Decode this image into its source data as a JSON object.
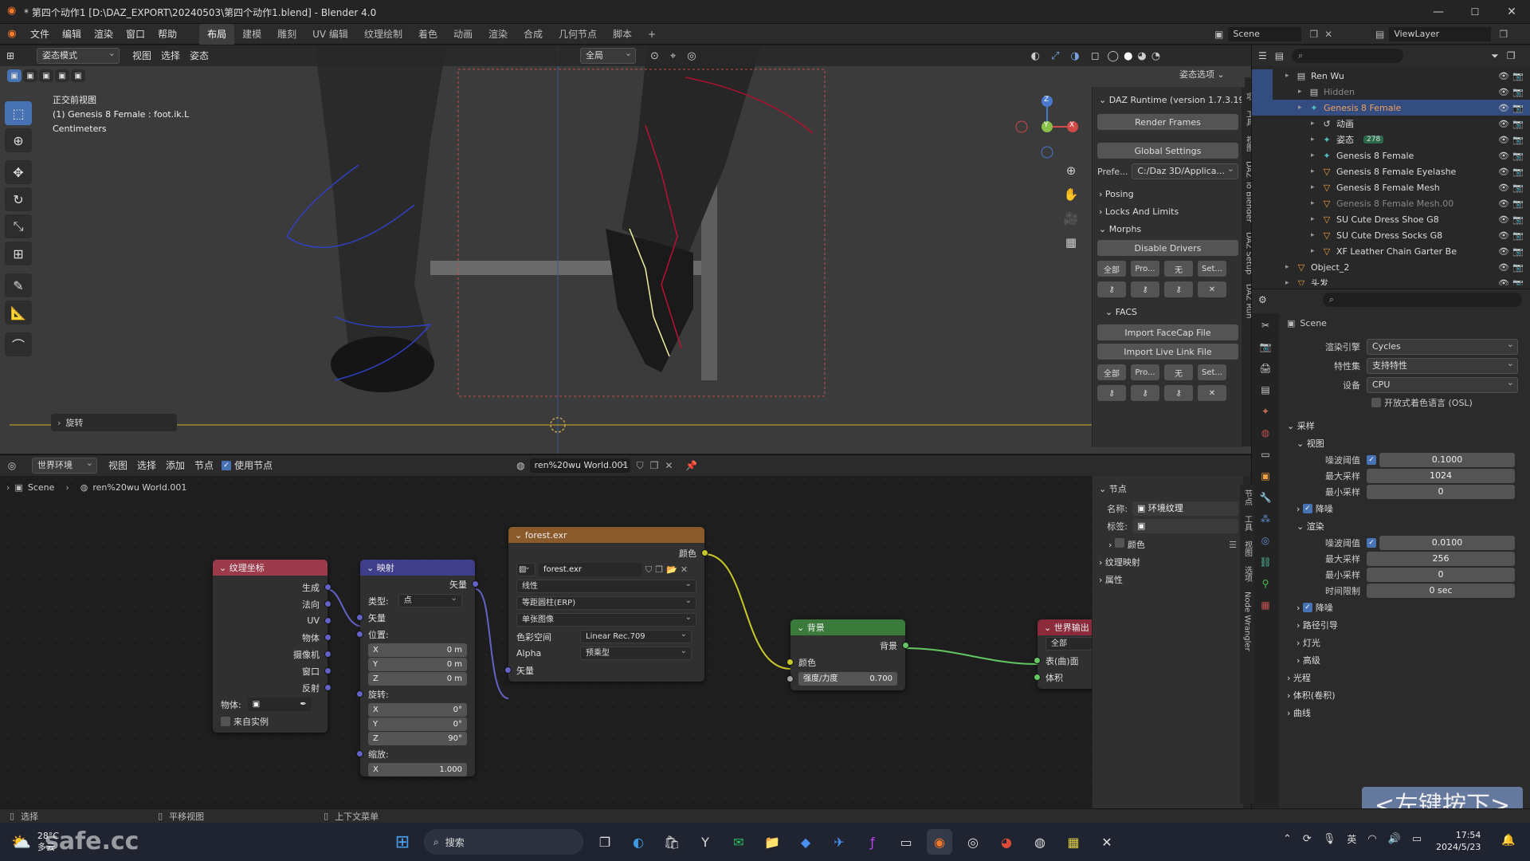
{
  "window": {
    "title": "* 第四个动作1 [D:\\DAZ_EXPORT\\20240503\\第四个动作1.blend] - Blender 4.0",
    "minimize": "—",
    "maximize": "☐",
    "close": "✕"
  },
  "menu": {
    "items": [
      "文件",
      "编辑",
      "渲染",
      "窗口",
      "帮助"
    ],
    "workspace_tabs": [
      "布局",
      "建模",
      "雕刻",
      "UV 编辑",
      "纹理绘制",
      "着色",
      "动画",
      "渲染",
      "合成",
      "几何节点",
      "脚本"
    ],
    "active_tab": "布局",
    "add_tab": "+",
    "scene_label": "Scene",
    "viewlayer_label": "ViewLayer"
  },
  "viewport": {
    "mode": "姿态模式",
    "menus": [
      "视图",
      "选择",
      "姿态"
    ],
    "orientation": "全局",
    "options": "姿态选项",
    "info_line1": "正交前视图",
    "info_line2": "(1) Genesis 8 Female : foot.ik.L",
    "info_line3": "Centimeters",
    "last_op": "旋转",
    "gizmo": {
      "z": "Z",
      "y": "Y",
      "x": "X"
    }
  },
  "npanel": {
    "header": "DAZ Runtime (version 1.7.3.19",
    "render_frames": "Render Frames",
    "global_settings": "Global Settings",
    "prefs_label": "Prefe...",
    "prefs_value": "C:/Daz 3D/Applica...",
    "posing": "Posing",
    "locks": "Locks And Limits",
    "morphs": "Morphs",
    "disable_drivers": "Disable Drivers",
    "small_btns": [
      "全部",
      "Pro...",
      "无",
      "Set..."
    ],
    "facs": "FACS",
    "import_facecap": "Import FaceCap File",
    "import_livelink": "Import Live Link File",
    "tabs": [
      "项",
      "工具",
      "视图",
      "DAZ To Blender",
      "DAZ Setup",
      "DAZ Run"
    ]
  },
  "outliner": {
    "rows": [
      {
        "label": "Ren Wu",
        "indent": 1,
        "icon": "▤",
        "color": "#ddd"
      },
      {
        "label": "Hidden",
        "indent": 2,
        "icon": "▤",
        "color": "#888"
      },
      {
        "label": "Genesis 8 Female",
        "indent": 2,
        "icon": "✦",
        "color": "#f0a060",
        "sel": true
      },
      {
        "label": "动画",
        "indent": 3,
        "icon": "↺",
        "color": "#ddd"
      },
      {
        "label": "姿态",
        "indent": 3,
        "icon": "✦",
        "color": "#ddd"
      },
      {
        "label": "Genesis 8 Female",
        "indent": 3,
        "icon": "✦",
        "color": "#ddd"
      },
      {
        "label": "Genesis 8 Female Eyelashe",
        "indent": 3,
        "icon": "▽",
        "color": "#ddd"
      },
      {
        "label": "Genesis 8 Female Mesh",
        "indent": 3,
        "icon": "▽",
        "color": "#ddd"
      },
      {
        "label": "Genesis 8 Female Mesh.00",
        "indent": 3,
        "icon": "▽",
        "color": "#888"
      },
      {
        "label": "SU Cute Dress Shoe G8",
        "indent": 3,
        "icon": "▽",
        "color": "#ddd"
      },
      {
        "label": "SU Cute Dress Socks G8",
        "indent": 3,
        "icon": "▽",
        "color": "#ddd"
      },
      {
        "label": "XF Leather Chain Garter Be",
        "indent": 3,
        "icon": "▽",
        "color": "#ddd"
      },
      {
        "label": "Object_2",
        "indent": 1,
        "icon": "▽",
        "color": "#ddd"
      },
      {
        "label": "头发",
        "indent": 1,
        "icon": "▽",
        "color": "#ddd"
      }
    ],
    "badge": "278"
  },
  "properties": {
    "scene": "Scene",
    "render_engine_label": "渲染引擎",
    "render_engine": "Cycles",
    "feature_set_label": "特性集",
    "feature_set": "支持特性",
    "device_label": "设备",
    "device": "CPU",
    "osl": "开放式着色语言 (OSL)",
    "sampling": "采样",
    "viewport": "视图",
    "noise_threshold_label": "噪波阈值",
    "viewport_noise": "0.1000",
    "max_samples_label": "最大采样",
    "viewport_max": "1024",
    "min_samples_label": "最小采样",
    "viewport_min": "0",
    "denoise": "降噪",
    "render": "渲染",
    "render_noise": "0.0100",
    "render_max": "256",
    "render_min": "0",
    "time_limit_label": "时间限制",
    "time_limit": "0 sec",
    "path_guiding": "路径引导",
    "lights": "灯光",
    "advanced": "高级",
    "light_paths": "光程",
    "volumes": "体积(卷积)",
    "curves": "曲线"
  },
  "node_editor": {
    "type": "世界环境",
    "menus": [
      "视图",
      "选择",
      "添加",
      "节点"
    ],
    "use_nodes": "使用节点",
    "world_name": "ren%20wu World.001",
    "breadcrumb_scene": "Scene",
    "breadcrumb_world": "ren%20wu World.001",
    "texcoord": {
      "title": "纹理坐标",
      "outputs": [
        "生成",
        "法向",
        "UV",
        "物体",
        "摄像机",
        "窗口",
        "反射"
      ],
      "object_label": "物体:",
      "from_instancer": "来自实例"
    },
    "mapping": {
      "title": "映射",
      "output": "矢量",
      "type_label": "类型:",
      "type_value": "点",
      "vector": "矢量",
      "location": "位置:",
      "loc": [
        [
          "X",
          "0 m"
        ],
        [
          "Y",
          "0 m"
        ],
        [
          "Z",
          "0 m"
        ]
      ],
      "rotation": "旋转:",
      "rot": [
        [
          "X",
          "0°"
        ],
        [
          "Y",
          "0°"
        ],
        [
          "Z",
          "90°"
        ]
      ],
      "scale": "缩放:",
      "scl": [
        [
          "X",
          "1.000"
        ]
      ]
    },
    "envtex": {
      "title": "forest.exr",
      "output": "颜色",
      "image": "forest.exr",
      "interp": "线性",
      "proj": "等距圆柱(ERP)",
      "source": "单张图像",
      "colorspace_label": "色彩空间",
      "colorspace": "Linear Rec.709",
      "alpha_label": "Alpha",
      "alpha": "预乘型",
      "input": "矢量"
    },
    "background": {
      "title": "背景",
      "output": "背景",
      "color": "颜色",
      "strength_label": "强度/力度",
      "strength": "0.700"
    },
    "world_output": {
      "title": "世界输出",
      "target": "全部",
      "surface": "表(曲)面",
      "volume": "体积"
    },
    "side": {
      "node": "节点",
      "name_label": "名称:",
      "name_value": "环境纹理",
      "label_label": "标签:",
      "color": "颜色",
      "texture_mapping": "纹理映射",
      "properties": "属性",
      "tabs": [
        "节点",
        "工具",
        "视图",
        "选项",
        "Node Wrangler"
      ]
    }
  },
  "statusbar": {
    "select": "选择",
    "pan": "平移视图",
    "context": "上下文菜单"
  },
  "overlay_hint": "<左键按下>",
  "watermark": "safe.cc",
  "taskbar": {
    "weather_temp": "28°C",
    "weather_desc": "多云",
    "search": "搜索",
    "lang": "英",
    "time": "17:54",
    "date": "2024/5/23"
  }
}
